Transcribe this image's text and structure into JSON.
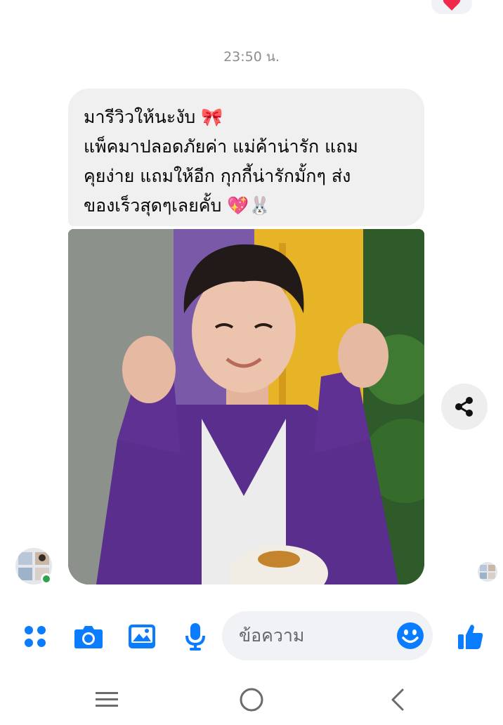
{
  "thread": {
    "timestamp": "23:50 น.",
    "reaction_icon": "heart-icon",
    "message": {
      "text": "มารีวิวให้นะงับ 🎀\nแพ็คมาปลอดภัยค่า แม่ค้าน่ารัก แถม\nคุยง่าย แถมให้อีก กุกกี้น่ารักมั้กๆ ส่ง\nของเร็วสุดๆเลยคั้บ 💖🐰"
    },
    "photo_icon": "shared-photo"
  },
  "composer": {
    "placeholder": "ข้อความ",
    "tools": [
      "more-apps-icon",
      "camera-icon",
      "gallery-icon",
      "microphone-icon"
    ],
    "emoji_icon": "emoji-icon",
    "like_icon": "thumbs-up-icon"
  },
  "navigation": [
    "recent-apps-icon",
    "home-icon",
    "back-icon"
  ],
  "colors": {
    "accent": "#0a7cff",
    "bubble": "#f0f0f0",
    "timestamp": "#8a8d91",
    "online": "#31a24c",
    "reaction": "#f02849"
  }
}
